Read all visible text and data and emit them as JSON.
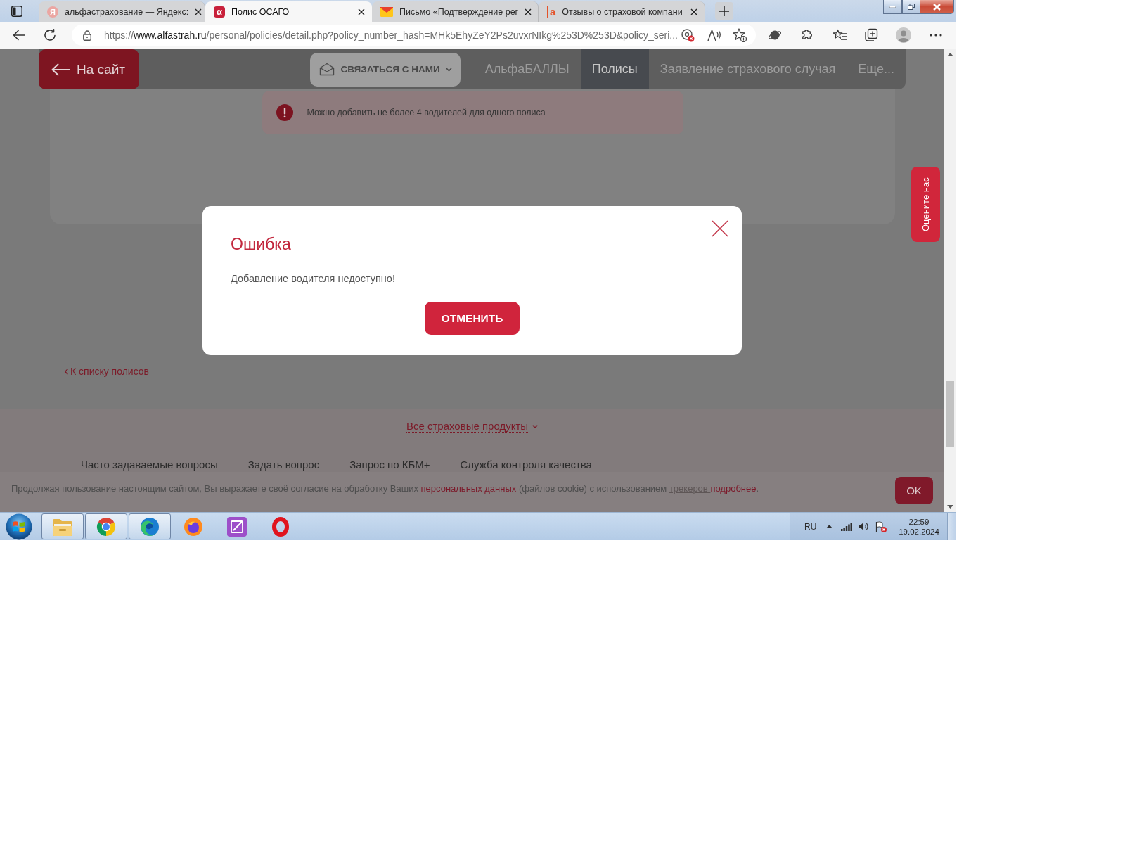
{
  "browser": {
    "tabs": [
      {
        "title": "альфастрахование — Яндекс:",
        "selected": false,
        "favicon": {
          "kind": "circle-letter",
          "text": "Я"
        }
      },
      {
        "title": "Полис ОСАГО",
        "selected": true,
        "favicon": {
          "kind": "tile-letter",
          "text": "α"
        }
      },
      {
        "title": "Письмо «Подтверждение рег",
        "selected": false,
        "favicon": {
          "kind": "envelope"
        }
      },
      {
        "title": "Отзывы о страховой компани",
        "selected": false,
        "favicon": {
          "kind": "bar-letter",
          "text": "a"
        }
      }
    ],
    "address": {
      "scheme": "https://",
      "host": "www.alfastrah.ru",
      "path": "/personal/policies/detail.php?policy_number_hash=MHk5EhyZeY2Ps2uvxrNIkg%253D%253D&policy_seri..."
    }
  },
  "site_nav": {
    "back_label": "На сайт",
    "contact_label": "СВЯЗАТЬСЯ С НАМИ",
    "items": [
      {
        "label": "АльфаБАЛЛЫ",
        "selected": false
      },
      {
        "label": "Полисы",
        "selected": true
      },
      {
        "label": "Заявление страхового случая",
        "selected": false
      },
      {
        "label": "Еще...",
        "selected": false
      }
    ]
  },
  "alert": {
    "text": "Можно добавить не более 4 водителей для одного полиса"
  },
  "back_link": "К списку полисов",
  "footer": {
    "products_link": "Все страховые продукты",
    "links": [
      "Часто задаваемые вопросы",
      "Задать вопрос",
      "Запрос по КБМ+",
      "Служба контроля качества"
    ]
  },
  "cookie_notice": {
    "parts": [
      {
        "kind": "text",
        "text": "Продолжая пользование настоящим сайтом, Вы выражаете своё согласие на обработку Ваших "
      },
      {
        "kind": "link",
        "text": "персональных данных"
      },
      {
        "kind": "text",
        "text": " (файлов cookie) с использованием "
      },
      {
        "kind": "underlined-link",
        "text": "трекеров "
      },
      {
        "kind": "link",
        "text": "подробнее"
      },
      {
        "kind": "text",
        "text": "."
      }
    ],
    "button": "OK"
  },
  "rate_tab": "Оцените нас",
  "dialog": {
    "title": "Ошибка",
    "message": "Добавление водителя недоступно!",
    "button": "ОТМЕНИТЬ"
  },
  "taskbar": {
    "apps": [
      {
        "kind": "folder",
        "running": true
      },
      {
        "kind": "segmented-circle",
        "running": true
      },
      {
        "kind": "swirl",
        "running": true
      },
      {
        "kind": "flame-globe",
        "running": false
      },
      {
        "kind": "pen-tile",
        "running": false
      },
      {
        "kind": "ring",
        "running": false
      }
    ],
    "tray": {
      "language": "RU",
      "time": "22:59",
      "date": "19.02.2024"
    }
  }
}
